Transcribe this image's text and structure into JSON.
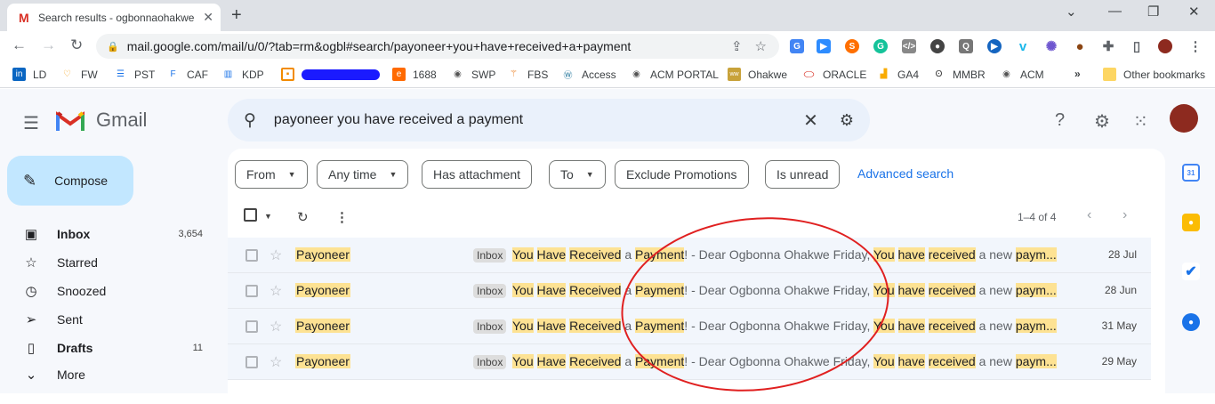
{
  "browser": {
    "tab_title": "Search results - ogbonnaohakwe",
    "tab_icon": "M",
    "url": "mail.google.com/mail/u/0/?tab=rm&ogbl#search/payoneer+you+have+received+a+payment"
  },
  "bookmarks": [
    {
      "label": "LD",
      "icon": "linkedin-icon",
      "color": "#0a66c2"
    },
    {
      "label": "FW",
      "icon": "fiverr-icon",
      "color": "#f5a623"
    },
    {
      "label": "PST",
      "icon": "stack-icon",
      "color": "#1a73e8"
    },
    {
      "label": "CAF",
      "icon": "caf-icon",
      "color": "#1a73e8"
    },
    {
      "label": "KDP",
      "icon": "chart-icon",
      "color": "#1a73e8"
    },
    {
      "label": "",
      "icon": "square-icon",
      "color": "#f28b00"
    },
    {
      "label": "1688",
      "icon": "1688-icon",
      "color": "#ff6a00"
    },
    {
      "label": "SWP",
      "icon": "globe-icon",
      "color": "#555"
    },
    {
      "label": "FBS",
      "icon": "fbs-icon",
      "color": "#e8710a"
    },
    {
      "label": "Access",
      "icon": "wordpress-icon",
      "color": "#21759b"
    },
    {
      "label": "ACM PORTAL",
      "icon": "globe-icon",
      "color": "#555"
    },
    {
      "label": "Ohakwe",
      "icon": "ohakwe-icon",
      "color": "#8a6d1a"
    },
    {
      "label": "ORACLE",
      "icon": "oracle-icon",
      "color": "#d93025"
    },
    {
      "label": "GA4",
      "icon": "analytics-icon",
      "color": "#f9ab00"
    },
    {
      "label": "MMBR",
      "icon": "owl-icon",
      "color": "#333"
    },
    {
      "label": "ACM",
      "icon": "globe-icon",
      "color": "#555"
    }
  ],
  "other_bookmarks": "Other bookmarks",
  "gmail": {
    "logo_text": "Gmail",
    "search_value": "payoneer you have received a payment",
    "compose": "Compose",
    "nav": [
      {
        "label": "Inbox",
        "count": "3,654",
        "icon": "inbox-icon",
        "bold": true
      },
      {
        "label": "Starred",
        "count": "",
        "icon": "star-icon",
        "bold": false
      },
      {
        "label": "Snoozed",
        "count": "",
        "icon": "clock-icon",
        "bold": false
      },
      {
        "label": "Sent",
        "count": "",
        "icon": "send-icon",
        "bold": false
      },
      {
        "label": "Drafts",
        "count": "11",
        "icon": "draft-icon",
        "bold": true
      },
      {
        "label": "More",
        "count": "",
        "icon": "chevron-down-icon",
        "bold": false
      }
    ],
    "chips": [
      "From",
      "Any time",
      "Has attachment",
      "To",
      "Exclude Promotions",
      "Is unread"
    ],
    "advanced_search": "Advanced search",
    "range": "1–4 of 4",
    "emails": [
      {
        "sender": "Payoneer",
        "label": "Inbox",
        "date": "28 Jul"
      },
      {
        "sender": "Payoneer",
        "label": "Inbox",
        "date": "28 Jun"
      },
      {
        "sender": "Payoneer",
        "label": "Inbox",
        "date": "31 May"
      },
      {
        "sender": "Payoneer",
        "label": "Inbox",
        "date": "29 May"
      }
    ],
    "subject_parts": {
      "w1": "You",
      "w2": "Have",
      "w3": "Received",
      "a": "a",
      "w4": "Payment",
      "mid": "! - Dear Ogbonna Ohakwe Friday, ",
      "w5": "You",
      "w6": "have",
      "w7": "received",
      "tail": " a new ",
      "w8": "paym..."
    }
  }
}
